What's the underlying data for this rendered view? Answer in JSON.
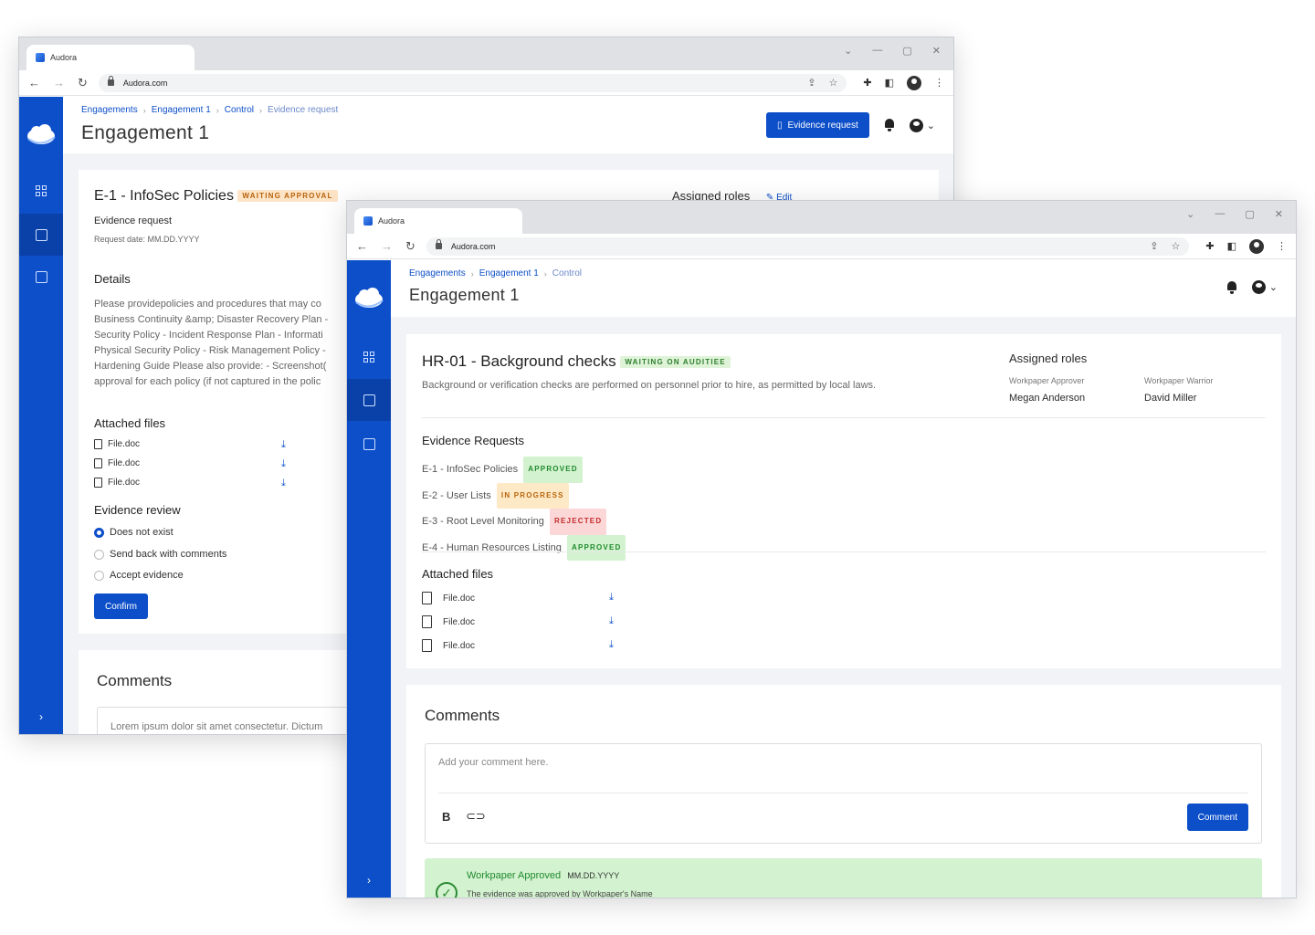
{
  "winA": {
    "tab_title": "Audora",
    "url": "Audora.com",
    "breadcrumbs": [
      "Engagements",
      "Engagement 1",
      "Control",
      "Evidence request"
    ],
    "page_title": "Engagement 1",
    "evidence_btn": "Evidence request",
    "card": {
      "title": "E-1 - InfoSec Policies",
      "badge": "WAITING APPROVAL",
      "assigned_roles": "Assigned roles",
      "edit": "Edit",
      "subtitle": "Evidence request",
      "request_date": "Request date: MM.DD.YYYY",
      "details_title": "Details",
      "details_lines": [
        "Please providepolicies and procedures that may co",
        "Business Continuity &amp; Disaster Recovery Plan -",
        "Security Policy - Incident Response Plan - Informati",
        "Physical Security Policy - Risk Management Policy -",
        "Hardening Guide Please also provide: - Screenshot(",
        "approval for each policy (if not captured in the polic"
      ],
      "attached_title": "Attached files",
      "files": [
        "File.doc",
        "File.doc",
        "File.doc"
      ],
      "review_title": "Evidence review",
      "review_options": [
        "Does not exist",
        "Send back with comments",
        "Accept evidence"
      ],
      "confirm": "Confirm"
    },
    "comments_title": "Comments",
    "comment_preview": "Lorem ipsum dolor sit amet consectetur. Dictum"
  },
  "winB": {
    "tab_title": "Audora",
    "url": "Audora.com",
    "breadcrumbs": [
      "Engagements",
      "Engagement 1",
      "Control"
    ],
    "page_title": "Engagement 1",
    "card": {
      "title": "HR-01 - Background checks",
      "badge": "WAITING ON AUDITIEE",
      "description": "Background or verification checks are performed on personnel prior to hire, as permitted by local laws.",
      "assigned_roles": "Assigned roles",
      "roles": [
        {
          "role": "Workpaper Approver",
          "name": "Megan Anderson"
        },
        {
          "role": "Workpaper Warrior",
          "name": "David Miller"
        }
      ],
      "requests_title": "Evidence Requests",
      "requests": [
        {
          "label": "E-1 - InfoSec Policies",
          "status": "APPROVED",
          "kind": "green"
        },
        {
          "label": "E-2 - User Lists",
          "status": "IN PROGRESS",
          "kind": "yellow"
        },
        {
          "label": "E-3 - Root Level Monitoring",
          "status": "REJECTED",
          "kind": "red"
        },
        {
          "label": "E-4 - Human Resources Listing",
          "status": "APPROVED",
          "kind": "green"
        }
      ],
      "attached_title": "Attached files",
      "files": [
        "File.doc",
        "File.doc",
        "File.doc"
      ]
    },
    "comments": {
      "title": "Comments",
      "placeholder": "Add your comment here.",
      "bold": "B",
      "button": "Comment",
      "approval_title": "Workpaper Approved",
      "approval_date": "MM.DD.YYYY",
      "approval_text": "The evidence was approved by Workpaper's Name"
    }
  },
  "colors": {
    "brand": "#0d4fc9",
    "sidebar_active": "#0a41a8",
    "approved_bg": "#d3f2cf"
  },
  "icons": [
    "cloud-logo-icon",
    "dashboard-icon",
    "documents-icon",
    "checklist-icon",
    "bell-icon",
    "user-icon",
    "download-icon",
    "file-icon",
    "link-icon",
    "check-circle-icon"
  ]
}
